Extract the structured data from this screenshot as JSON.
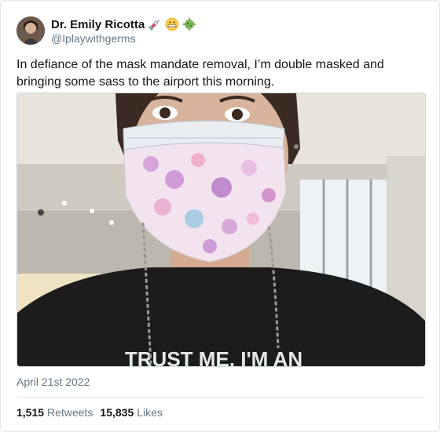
{
  "author": {
    "name": "Dr. Emily Ricotta",
    "handle": "@Iplaywithgerms",
    "emojis": [
      "syringe-icon",
      "grimacing-face-icon",
      "microbe-icon"
    ]
  },
  "tweet": {
    "text": "In defiance of the mask mandate removal, I’m double masked and bringing some sass to the airport this morning.",
    "date": "April 21st 2022",
    "photo_text": "TRUST ME, I'M AN"
  },
  "stats": {
    "retweets_count": "1,515",
    "retweets_label": "Retweets",
    "likes_count": "15,835",
    "likes_label": "Likes"
  },
  "colors": {
    "text": "#14171a",
    "secondary": "#657786",
    "border": "#e1e8ed"
  }
}
